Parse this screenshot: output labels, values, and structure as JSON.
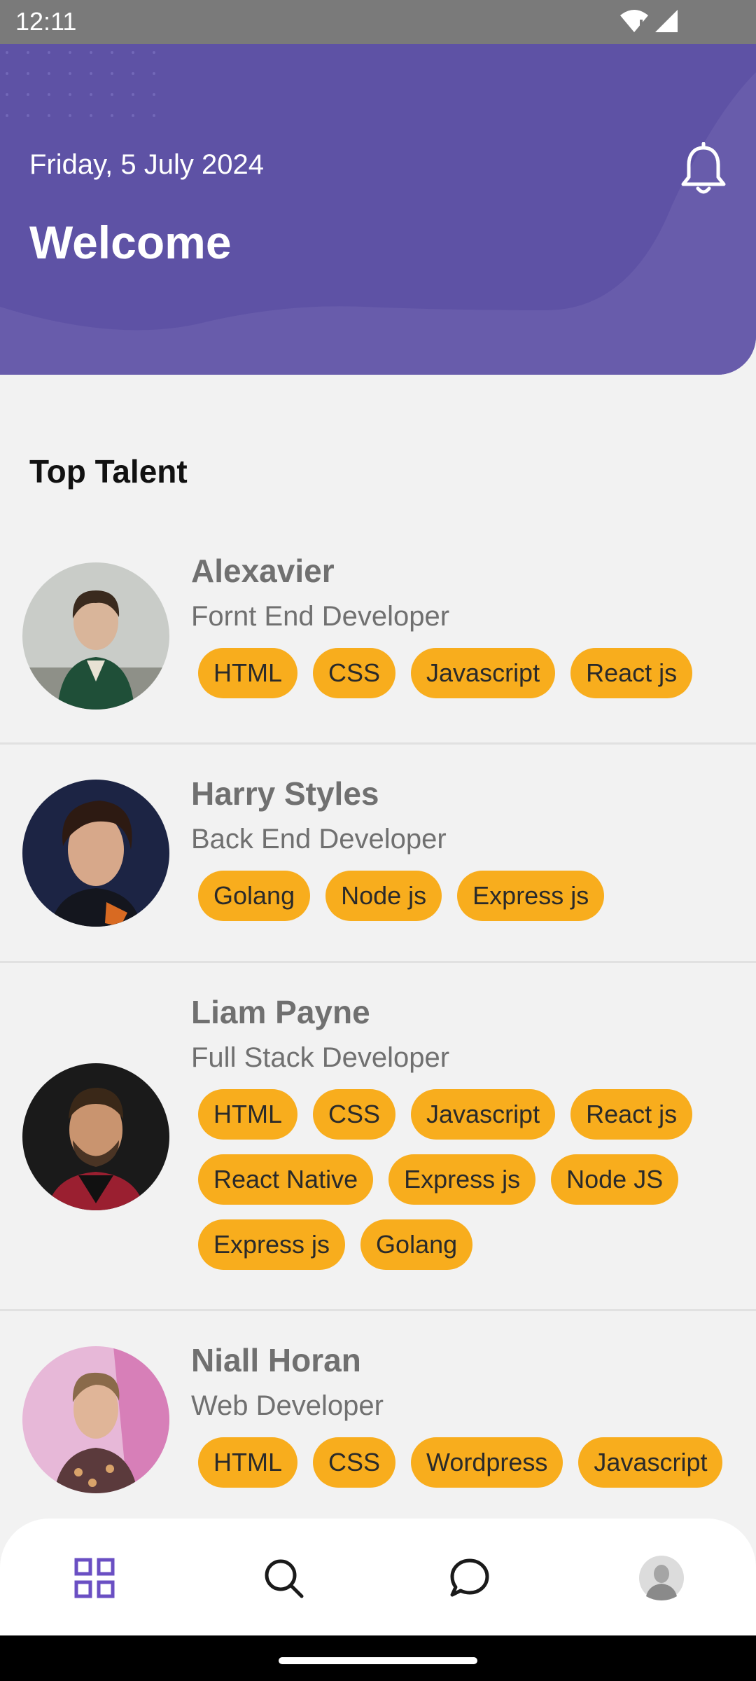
{
  "status_bar": {
    "time": "12:11"
  },
  "header": {
    "date": "Friday, 5 July 2024",
    "welcome": "Welcome",
    "bg_color": "#5e52a5"
  },
  "section": {
    "title": "Top Talent"
  },
  "talents": [
    {
      "name": "Alexavier",
      "role": "Fornt End Developer",
      "skills": [
        "HTML",
        "CSS",
        "Javascript",
        "React js"
      ]
    },
    {
      "name": "Harry Styles",
      "role": "Back End Developer",
      "skills": [
        "Golang",
        "Node js",
        "Express js"
      ]
    },
    {
      "name": "Liam Payne",
      "role": "Full Stack Developer",
      "skills": [
        "HTML",
        "CSS",
        "Javascript",
        "React js",
        "React Native",
        "Express js",
        "Node JS",
        "Express js",
        "Golang"
      ]
    },
    {
      "name": "Niall Horan",
      "role": "Web Developer",
      "skills": [
        "HTML",
        "CSS",
        "Wordpress",
        "Javascript"
      ]
    }
  ],
  "bottom_nav": {
    "items": [
      {
        "icon": "grid-icon",
        "active": true
      },
      {
        "icon": "search-icon",
        "active": false
      },
      {
        "icon": "chat-icon",
        "active": false
      },
      {
        "icon": "profile-avatar",
        "active": false
      }
    ],
    "active_color": "#6a4fc3"
  },
  "colors": {
    "accent": "#5e52a5",
    "chip": "#f8ad1d",
    "background": "#f2f2f2"
  }
}
